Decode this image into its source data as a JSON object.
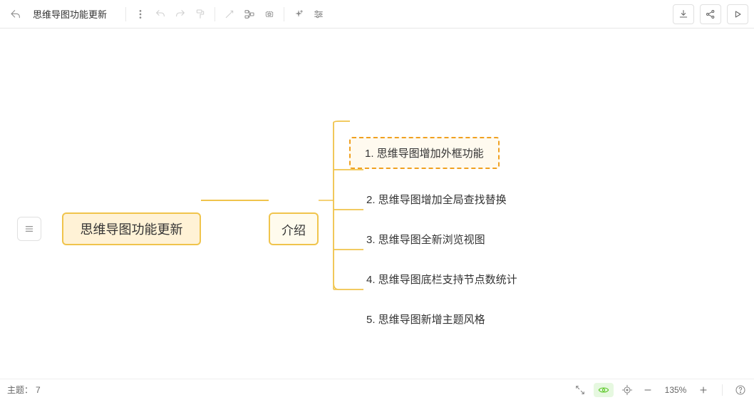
{
  "document": {
    "title": "思维导图功能更新"
  },
  "toolbar": {
    "icons": {
      "back": "back-icon",
      "more": "more-icon",
      "undo": "undo-icon",
      "redo": "redo-icon",
      "format": "format-paint-icon",
      "pointer": "pointer-icon",
      "addnode": "add-node-icon",
      "boundary": "boundary-icon",
      "ai": "ai-sparkle-icon",
      "settings": "adjustments-icon",
      "download": "download-icon",
      "share": "share-icon",
      "play": "play-icon"
    }
  },
  "panel": {
    "settings_icon": "sliders-icon"
  },
  "mindmap": {
    "root": "思维导图功能更新",
    "branch": "介绍",
    "leaves": [
      "1. 思维导图增加外框功能",
      "2. 思维导图增加全局查找替换",
      "3. 思维导图全新浏览视图",
      "4. 思维导图底栏支持节点数统计",
      "5. 思维导图新增主题风格"
    ],
    "selected_index": 0
  },
  "outline": {
    "toggle_icon": "menu-icon"
  },
  "status": {
    "topic_label": "主题：",
    "topic_count": "7",
    "zoom": "135%",
    "icons": {
      "fit": "fit-screen-icon",
      "preview": "eye-icon",
      "location": "location-icon",
      "minus": "minus-icon",
      "plus": "plus-icon",
      "help": "help-icon"
    }
  },
  "colors": {
    "stroke": "#f0c44c",
    "bg_root": "#fff2d6",
    "bg_sub": "#fffbed",
    "dashed": "#f0a020"
  }
}
